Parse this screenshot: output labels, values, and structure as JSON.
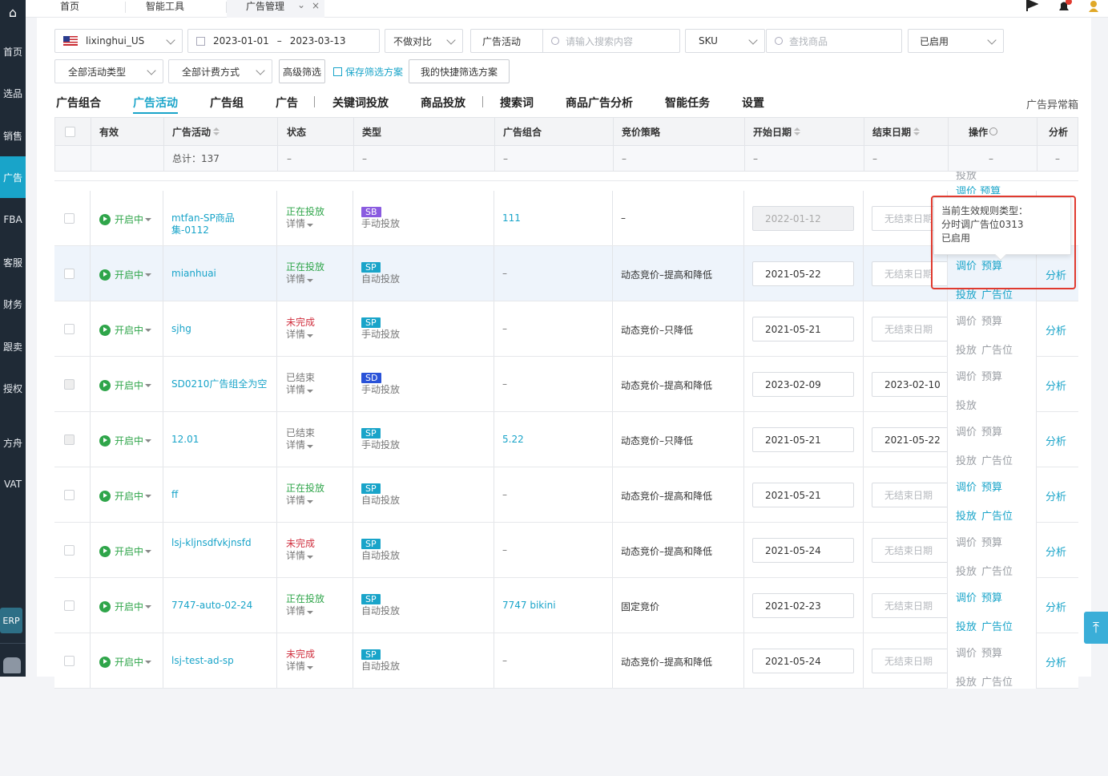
{
  "sidebar": {
    "items": [
      {
        "label": "首页"
      },
      {
        "label": "选品"
      },
      {
        "label": "销售"
      },
      {
        "label": "广告"
      },
      {
        "label": "FBA"
      },
      {
        "label": "客服"
      },
      {
        "label": "财务"
      },
      {
        "label": "跟卖"
      },
      {
        "label": "授权"
      },
      {
        "label": "方舟"
      },
      {
        "label": "VAT"
      }
    ],
    "erp_label": "ERP"
  },
  "topbar": {
    "tabs": [
      {
        "label": "首页"
      },
      {
        "label": "智能工具"
      },
      {
        "label": "广告管理"
      }
    ],
    "close_glyph": "×",
    "chevron_glyph": "⌄"
  },
  "filters": {
    "account": "lixinghui_US",
    "date_start": "2023-01-01",
    "date_sep": "–",
    "date_end": "2023-03-13",
    "compare": "不做对比",
    "search_scope": "广告活动",
    "search_placeholder": "请输入搜索内容",
    "sku": "SKU",
    "product_placeholder": "查找商品",
    "enabled": "已启用",
    "activity_type": "全部活动类型",
    "billing": "全部计费方式",
    "advanced": "高级筛选",
    "save_plan": "保存筛选方案",
    "my_plans": "我的快捷筛选方案"
  },
  "subtabs": [
    {
      "label": "广告组合"
    },
    {
      "label": "广告活动"
    },
    {
      "label": "广告组"
    },
    {
      "label": "广告"
    },
    {
      "label": "关键词投放"
    },
    {
      "label": "商品投放"
    },
    {
      "label": "搜索词"
    },
    {
      "label": "商品广告分析"
    },
    {
      "label": "智能任务"
    },
    {
      "label": "设置"
    }
  ],
  "abnormal_box": "广告异常箱",
  "table": {
    "headers": {
      "valid": "有效",
      "campaign": "广告活动",
      "status": "状态",
      "type": "类型",
      "portfolio": "广告组合",
      "bid": "竞价策略",
      "start": "开始日期",
      "end": "结束日期",
      "ops": "操作",
      "analyze": "分析"
    },
    "total_label": "总计：137",
    "dash": "–",
    "valid_label": "开启中",
    "detail_label": "详情",
    "analyze_label": "分析",
    "op_labels": {
      "adjust": "调价",
      "budget": "预算",
      "targeting": "投放",
      "placement": "广告位"
    },
    "partial_top_op": "投放",
    "partial_mid_ops": "调价  预算",
    "rows": [
      {
        "name": "mtfan-SP商品集-0112",
        "status": "正在投放",
        "status_kind": "run",
        "badge": "SB",
        "type": "手动投放",
        "portfolio": "111",
        "bid": "–",
        "start": "2022-01-12",
        "start_kind": "gray",
        "end": "无结束日期",
        "end_kind": "ph",
        "ops_on": true,
        "placement": true,
        "cb_dis": false
      },
      {
        "name": "mianhuai",
        "status": "正在投放",
        "status_kind": "run",
        "badge": "SP",
        "type": "自动投放",
        "portfolio": "–",
        "bid": "动态竞价–提高和降低",
        "start": "2021-05-22",
        "start_kind": "",
        "end": "无结束日期",
        "end_kind": "ph",
        "ops_on": true,
        "placement": true,
        "cb_dis": false
      },
      {
        "name": "sjhg",
        "status": "未完成",
        "status_kind": "inc",
        "badge": "SP",
        "type": "手动投放",
        "portfolio": "–",
        "bid": "动态竞价–只降低",
        "start": "2021-05-21",
        "start_kind": "",
        "end": "无结束日期",
        "end_kind": "ph",
        "ops_on": false,
        "placement": true,
        "cb_dis": false
      },
      {
        "name": "SD0210广告组全为空",
        "status": "已结束",
        "status_kind": "end",
        "badge": "SD",
        "type": "手动投放",
        "portfolio": "–",
        "bid": "动态竞价–提高和降低",
        "start": "2023-02-09",
        "start_kind": "",
        "end": "2023-02-10",
        "end_kind": "",
        "ops_on": false,
        "placement": false,
        "cb_dis": true
      },
      {
        "name": "12.01",
        "status": "已结束",
        "status_kind": "end",
        "badge": "SP",
        "type": "手动投放",
        "portfolio": "5.22",
        "bid": "动态竞价–只降低",
        "start": "2021-05-21",
        "start_kind": "",
        "end": "2021-05-22",
        "end_kind": "",
        "ops_on": false,
        "placement": true,
        "cb_dis": true
      },
      {
        "name": "ff",
        "status": "正在投放",
        "status_kind": "run",
        "badge": "SP",
        "type": "自动投放",
        "portfolio": "–",
        "bid": "动态竞价–提高和降低",
        "start": "2021-05-21",
        "start_kind": "",
        "end": "无结束日期",
        "end_kind": "ph",
        "ops_on": true,
        "placement": true,
        "cb_dis": false
      },
      {
        "name": "lsj-kljnsdfvkjnsfd",
        "status": "未完成",
        "status_kind": "inc",
        "badge": "SP",
        "type": "自动投放",
        "portfolio": "–",
        "bid": "动态竞价–提高和降低",
        "start": "2021-05-24",
        "start_kind": "",
        "end": "无结束日期",
        "end_kind": "ph",
        "ops_on": false,
        "placement": true,
        "cb_dis": false
      },
      {
        "name": "7747-auto-02-24",
        "status": "正在投放",
        "status_kind": "run",
        "badge": "SP",
        "type": "自动投放",
        "portfolio": "7747 bikini",
        "bid": "固定竞价",
        "start": "2021-02-23",
        "start_kind": "",
        "end": "无结束日期",
        "end_kind": "ph",
        "ops_on": true,
        "placement": true,
        "cb_dis": false
      },
      {
        "name": "lsj-test-ad-sp",
        "status": "未完成",
        "status_kind": "inc",
        "badge": "SP",
        "type": "自动投放",
        "portfolio": "–",
        "bid": "动态竞价–提高和降低",
        "start": "2021-05-24",
        "start_kind": "",
        "end": "无结束日期",
        "end_kind": "ph",
        "ops_on": false,
        "placement": true,
        "cb_dis": false
      }
    ]
  },
  "tooltip": {
    "line1": "当前生效规则类型：",
    "line2": "分时调广告位0313",
    "line3": "已启用"
  },
  "colors": {
    "accent": "#19a4c9",
    "sidebar": "#1f2a36",
    "success": "#2fa54a",
    "danger": "#d0303f",
    "highlight": "#e03a2f"
  }
}
